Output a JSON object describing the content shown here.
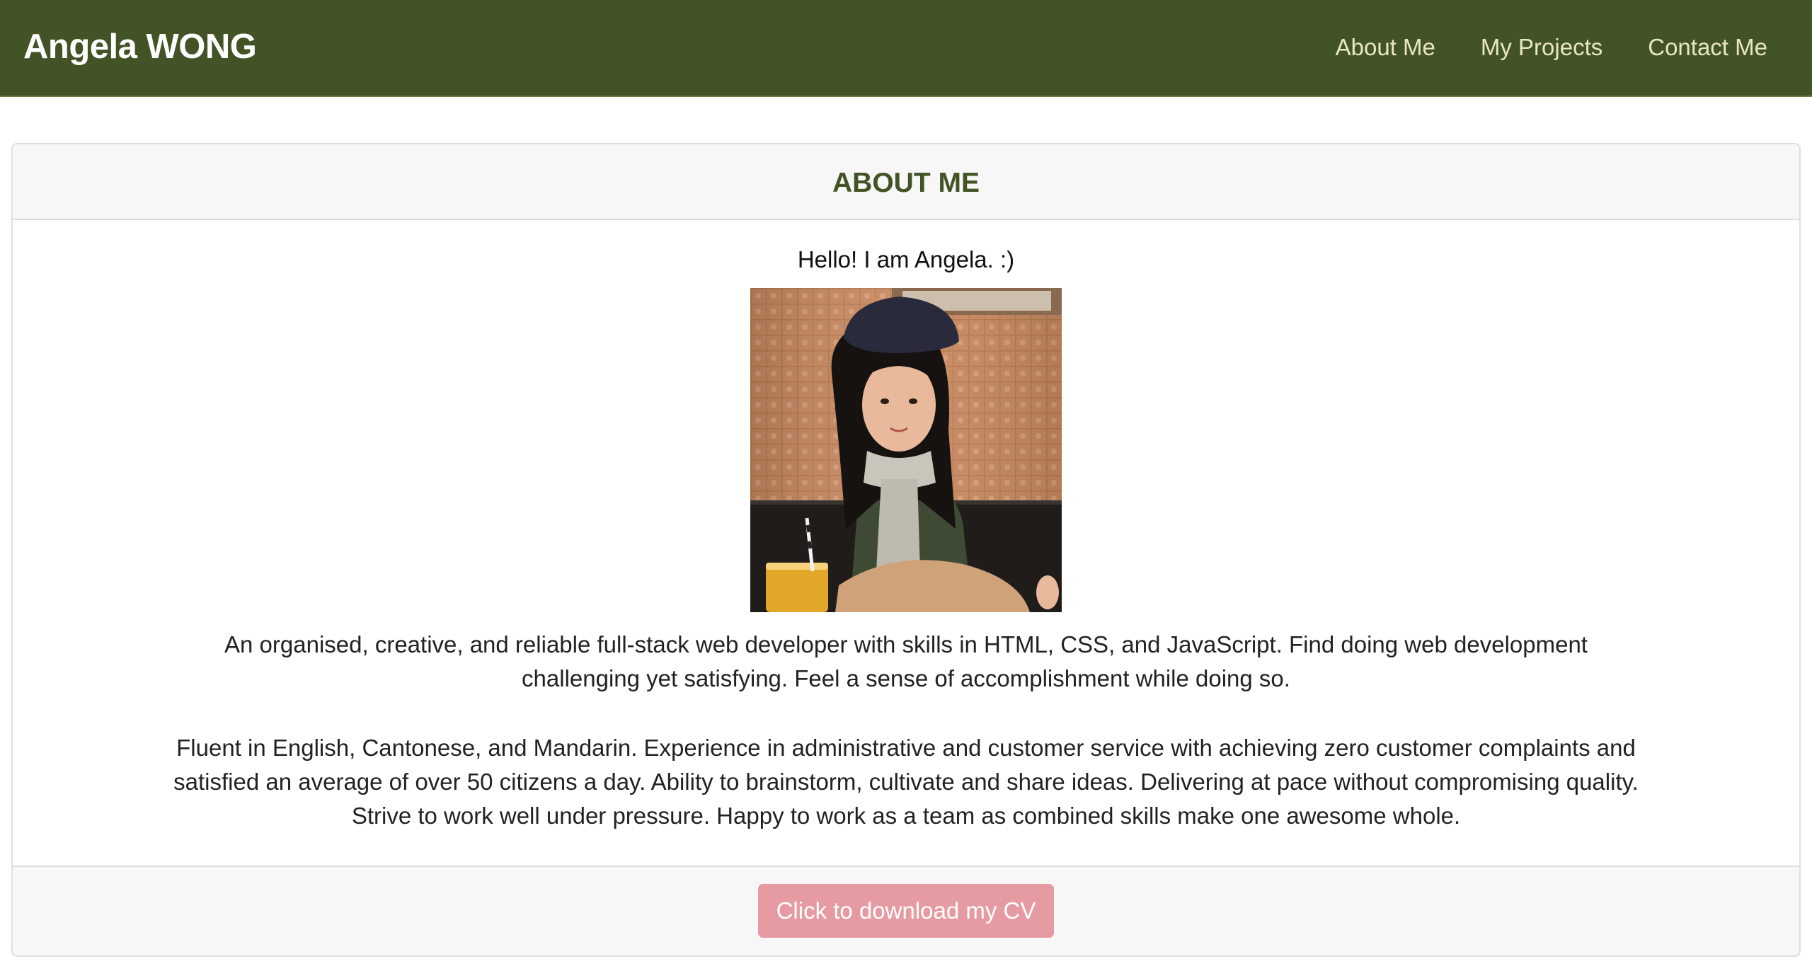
{
  "navbar": {
    "brand": "Angela WONG",
    "links": [
      "About Me",
      "My Projects",
      "Contact Me"
    ]
  },
  "about": {
    "heading": "ABOUT ME",
    "greeting": "Hello! I am Angela. :)",
    "paragraph1": "An organised, creative, and reliable full-stack web developer with skills in HTML, CSS, and JavaScript. Find doing web development challenging yet satisfying. Feel a sense of accomplishment while doing so.",
    "paragraph2": "Fluent in English, Cantonese, and Mandarin. Experience in administrative and customer service with achieving zero customer complaints and satisfied an average of over 50 citizens a day. Ability to brainstorm, cultivate and share ideas. Delivering at pace without compromising quality. Strive to work well under pressure. Happy to work as a team as combined skills make one awesome whole.",
    "cv_button": "Click to download my CV"
  },
  "colors": {
    "navbar_bg": "#425325",
    "heading": "#425325",
    "button_bg": "#e59ba1"
  }
}
